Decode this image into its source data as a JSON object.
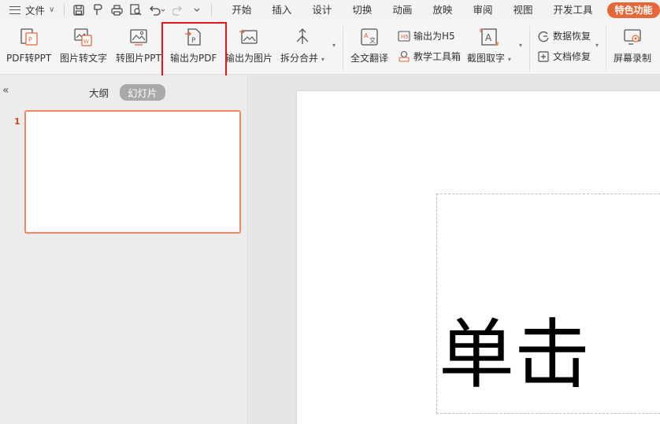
{
  "menubar": {
    "file_label": "文件",
    "tabs": [
      "开始",
      "插入",
      "设计",
      "切换",
      "动画",
      "放映",
      "审阅",
      "视图",
      "开发工具"
    ],
    "special_tab": "特色功能",
    "quick_access": [
      "save-icon",
      "format-painter-icon",
      "print-icon",
      "print-preview-icon",
      "undo-icon",
      "redo-icon",
      "customize-icon"
    ]
  },
  "ribbon": {
    "pdf_to_ppt": "PDF转PPT",
    "image_to_text": "图片转文字",
    "to_image_ppt": "转图片PPT",
    "export_pdf": "输出为PDF",
    "export_image": "输出为图片",
    "split_merge": "拆分合并",
    "full_translate": "全文翻译",
    "export_h5": "输出为H5",
    "teaching_toolbox": "教学工具箱",
    "screenshot_ocr": "截图取字",
    "data_recovery": "数据恢复",
    "doc_repair": "文档修复",
    "screen_record": "屏幕录制"
  },
  "left_panel": {
    "outline_tab": "大纲",
    "slides_tab": "幻灯片",
    "slide_number": "1"
  },
  "slide": {
    "title_text": "单击"
  },
  "colors": {
    "accent": "#e4683a",
    "thumb_border": "#f08762",
    "highlight": "#e8141a"
  }
}
